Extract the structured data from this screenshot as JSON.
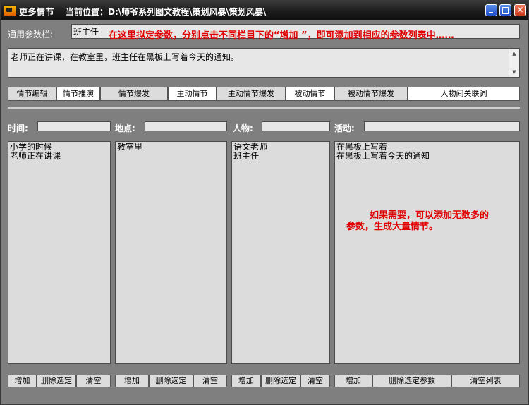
{
  "window": {
    "title": "更多情节",
    "path": "当前位置：D:\\师爷系列图文教程\\策划风暴\\策划风暴\\"
  },
  "param_bar": {
    "label": "通用参数栏:",
    "value": "班主任",
    "hint": "在这里拟定参数，分别点击不同栏目下的“增加 ”，即可添加到相应的参数列表中……"
  },
  "story_text": "老师正在讲课，在教室里，班主任在黑板上写着今天的通知。",
  "tabs": [
    {
      "label": "情节编辑"
    },
    {
      "label": "情节推演"
    },
    {
      "label": "情节爆发"
    },
    {
      "label": "主动情节"
    },
    {
      "label": "主动情节爆发"
    },
    {
      "label": "被动情节"
    },
    {
      "label": "被动情节爆发"
    },
    {
      "label": "人物间关联词"
    }
  ],
  "columns": {
    "time": {
      "label": "时间:",
      "items": [
        "小学的时候",
        "老师正在讲课"
      ]
    },
    "place": {
      "label": "地点:",
      "items": [
        "教室里"
      ]
    },
    "person": {
      "label": "人物:",
      "items": [
        "语文老师",
        "班主任"
      ]
    },
    "activity": {
      "label": "活动:",
      "items": [
        "在黑板上写着",
        "在黑板上写着今天的通知"
      ]
    }
  },
  "note": {
    "line1": "如果需要，可以添加无数多的",
    "line2": "参数，生成大量情节。"
  },
  "buttons": {
    "add": "增加",
    "delete_selected": "删除选定",
    "clear": "清空",
    "delete_selected_params": "删除选定参数",
    "clear_list": "清空列表"
  }
}
